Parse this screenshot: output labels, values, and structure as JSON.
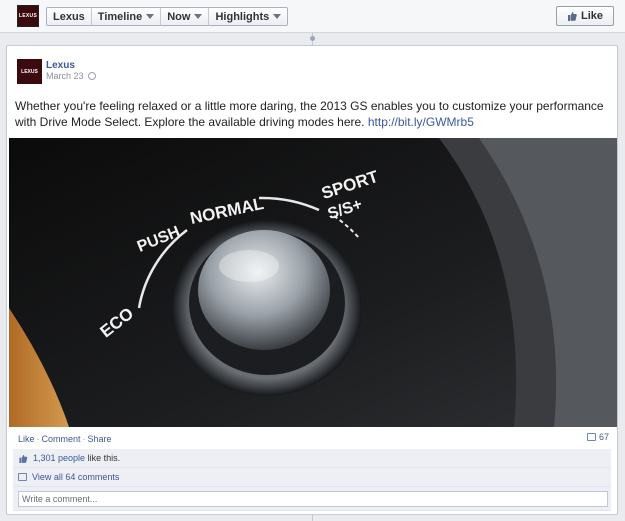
{
  "topbar": {
    "logo_text": "LEXUS",
    "crumbs": [
      "Lexus",
      "Timeline",
      "Now",
      "Highlights"
    ],
    "like_label": "Like"
  },
  "post": {
    "author": "Lexus",
    "date": "March 23",
    "text": "Whether you're feeling relaxed or a little more daring, the 2013 GS enables you to customize your performance with Drive Mode Select. Explore the available driving modes here.",
    "link": "http://bit.ly/GWMrb5",
    "photo_labels": {
      "eco": "ECO",
      "push": "PUSH",
      "normal": "NORMAL",
      "sport": "SPORT",
      "ss": "S/S+"
    },
    "actions": [
      "Like",
      "Comment",
      "Share"
    ],
    "action_sep": "·",
    "comment_count": "67",
    "likes_link": "1,301 people",
    "likes_suffix": "like this.",
    "view_comments": "View all 64 comments",
    "comment_placeholder": "Write a comment..."
  },
  "colors": {
    "link": "#3b5998",
    "background": "#e9ebee"
  }
}
